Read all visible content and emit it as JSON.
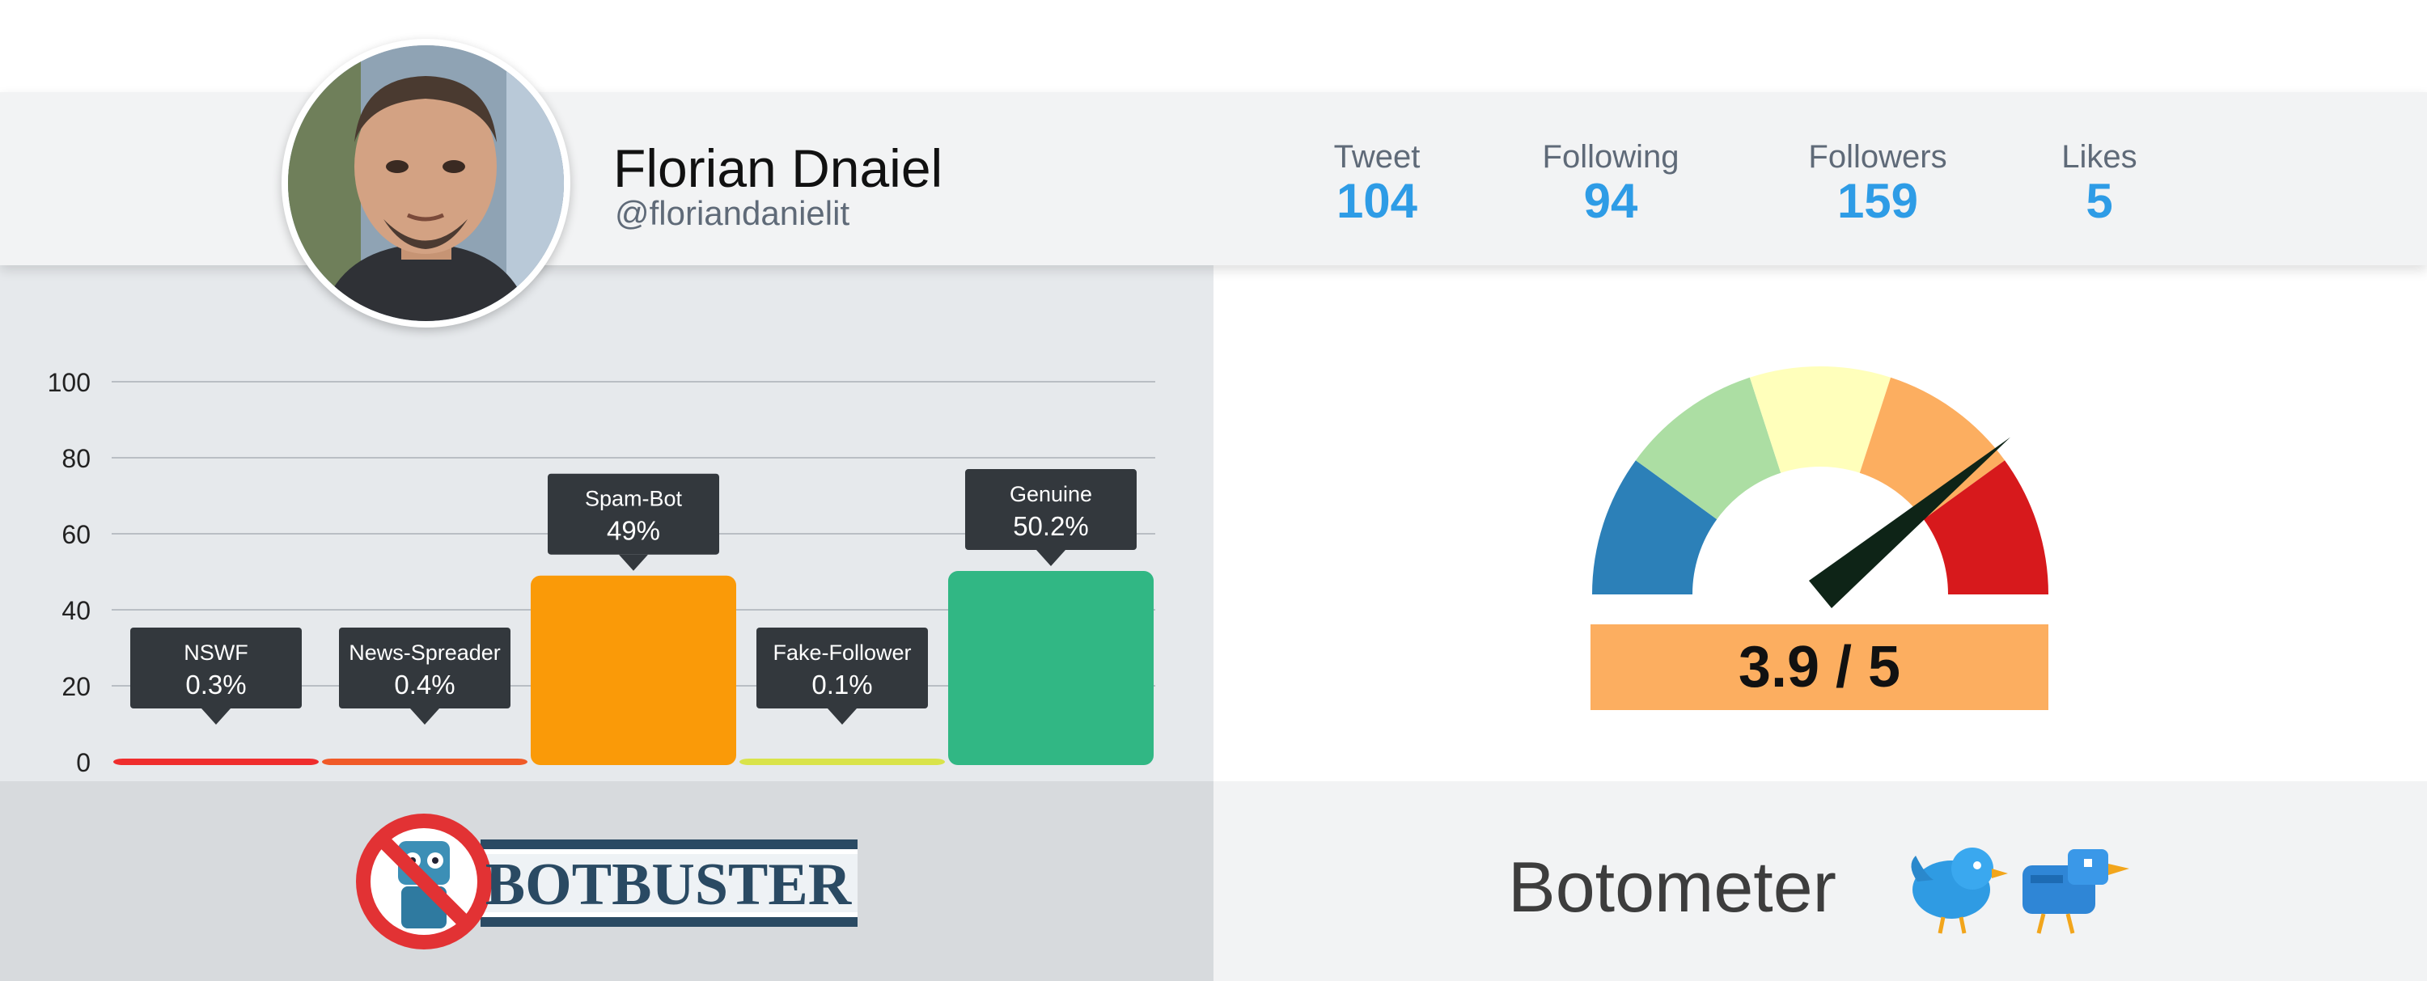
{
  "profile": {
    "name": "Florian Dnaiel",
    "handle": "@floriandanielit"
  },
  "stats": [
    {
      "label": "Tweet",
      "value": "104"
    },
    {
      "label": "Following",
      "value": "94"
    },
    {
      "label": "Followers",
      "value": "159"
    },
    {
      "label": "Likes",
      "value": "5"
    }
  ],
  "chart_data": {
    "type": "bar",
    "categories": [
      "NSWF",
      "News-Spreader",
      "Spam-Bot",
      "Fake-Follower",
      "Genuine"
    ],
    "values": [
      0.3,
      0.4,
      49,
      0.1,
      50.2
    ],
    "data_labels": [
      "0.3%",
      "0.4%",
      "49%",
      "0.1%",
      "50.2%"
    ],
    "colors": [
      "#ef2d2d",
      "#f05a28",
      "#fa9a08",
      "#d9e34a",
      "#31b784"
    ],
    "yticks": [
      "100",
      "80",
      "60",
      "40",
      "20",
      "0"
    ],
    "ylim": [
      0,
      100
    ],
    "grid": true
  },
  "gauge": {
    "score": 3.9,
    "max": 5,
    "score_text": "3.9 / 5",
    "segment_colors": [
      "#2c80b8",
      "#acdea3",
      "#ffffbb",
      "#fcae60",
      "#d7191c"
    ],
    "needle_color": "#0e2417"
  },
  "footer": {
    "botbuster_logo_text": "BOTBUSTER",
    "botometer_title": "Botometer"
  }
}
